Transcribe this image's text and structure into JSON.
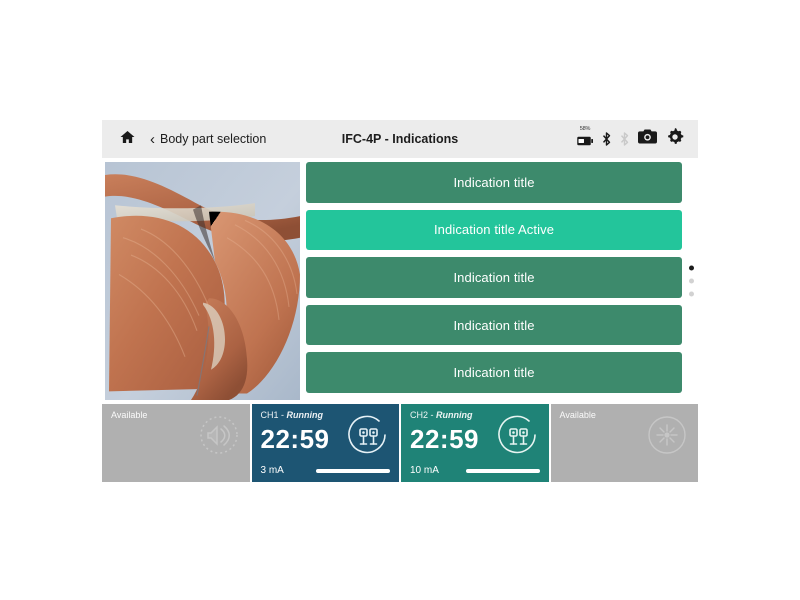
{
  "header": {
    "home_icon": "home-icon",
    "back_chevron": "‹",
    "back_label": "Body part selection",
    "title": "IFC-4P - Indications",
    "battery_percent": "58%",
    "icons": [
      "battery-icon",
      "bluetooth-icon",
      "wifi-icon",
      "camera-icon",
      "gear-icon"
    ]
  },
  "main": {
    "anatomy_image_alt": "shoulder-muscle-anatomy",
    "indications": [
      {
        "label": "Indication title",
        "active": false
      },
      {
        "label": "Indication title Active",
        "active": true
      },
      {
        "label": "Indication title",
        "active": false
      },
      {
        "label": "Indication title",
        "active": false
      },
      {
        "label": "Indication title",
        "active": false
      }
    ],
    "pager": {
      "total": 3,
      "current": 1
    }
  },
  "channels": [
    {
      "type": "available",
      "status": "Available",
      "icon": "ultrasound-icon"
    },
    {
      "type": "active",
      "name": "CH1",
      "separator": " - ",
      "state": "Running",
      "time": "22:59",
      "current": "3 mA",
      "icon": "electrode-pads-icon",
      "color": "#1d5573"
    },
    {
      "type": "active",
      "name": "CH2",
      "separator": " - ",
      "state": "Running",
      "time": "22:59",
      "current": "10 mA",
      "icon": "electrode-pads-icon",
      "color": "#1f8377"
    },
    {
      "type": "available",
      "status": "Available",
      "icon": "laser-icon"
    }
  ],
  "colors": {
    "indication_inactive": "#3d8a6c",
    "indication_active": "#23c59b",
    "header_bg": "#ececec",
    "available_bg": "#b0b0b0"
  }
}
